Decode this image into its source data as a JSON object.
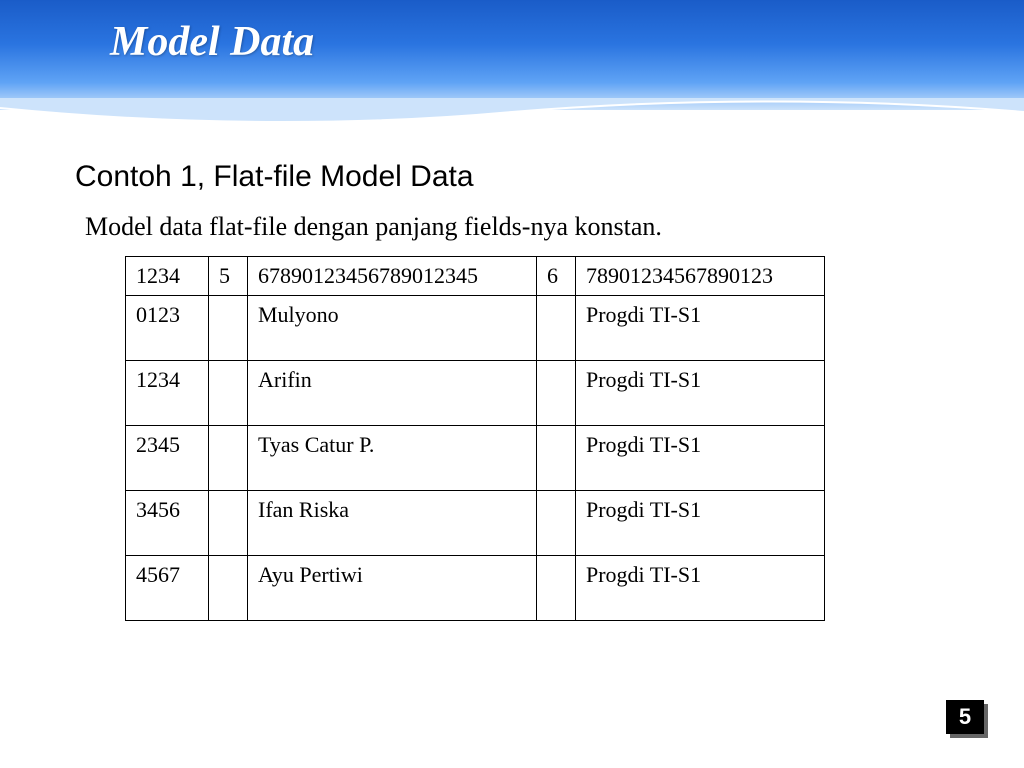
{
  "header": {
    "title": "Model Data"
  },
  "body": {
    "subtitle": "Contoh 1, Flat-file Model Data",
    "description": "Model data flat-file dengan panjang fields-nya konstan."
  },
  "table": {
    "header": {
      "c1": "1234",
      "c2": "5",
      "c3": "67890123456789012345",
      "c4": "6",
      "c5": "78901234567890123"
    },
    "rows": [
      {
        "c1": "0123",
        "c2": "",
        "c3": "Mulyono",
        "c4": "",
        "c5": "Progdi TI-S1"
      },
      {
        "c1": "1234",
        "c2": "",
        "c3": "Arifin",
        "c4": "",
        "c5": "Progdi TI-S1"
      },
      {
        "c1": "2345",
        "c2": "",
        "c3": "Tyas Catur P.",
        "c4": "",
        "c5": "Progdi TI-S1"
      },
      {
        "c1": "3456",
        "c2": "",
        "c3": "Ifan Riska",
        "c4": "",
        "c5": "Progdi TI-S1"
      },
      {
        "c1": "4567",
        "c2": "",
        "c3": "Ayu Pertiwi",
        "c4": "",
        "c5": "Progdi TI-S1"
      }
    ]
  },
  "footer": {
    "page_number": "5"
  }
}
